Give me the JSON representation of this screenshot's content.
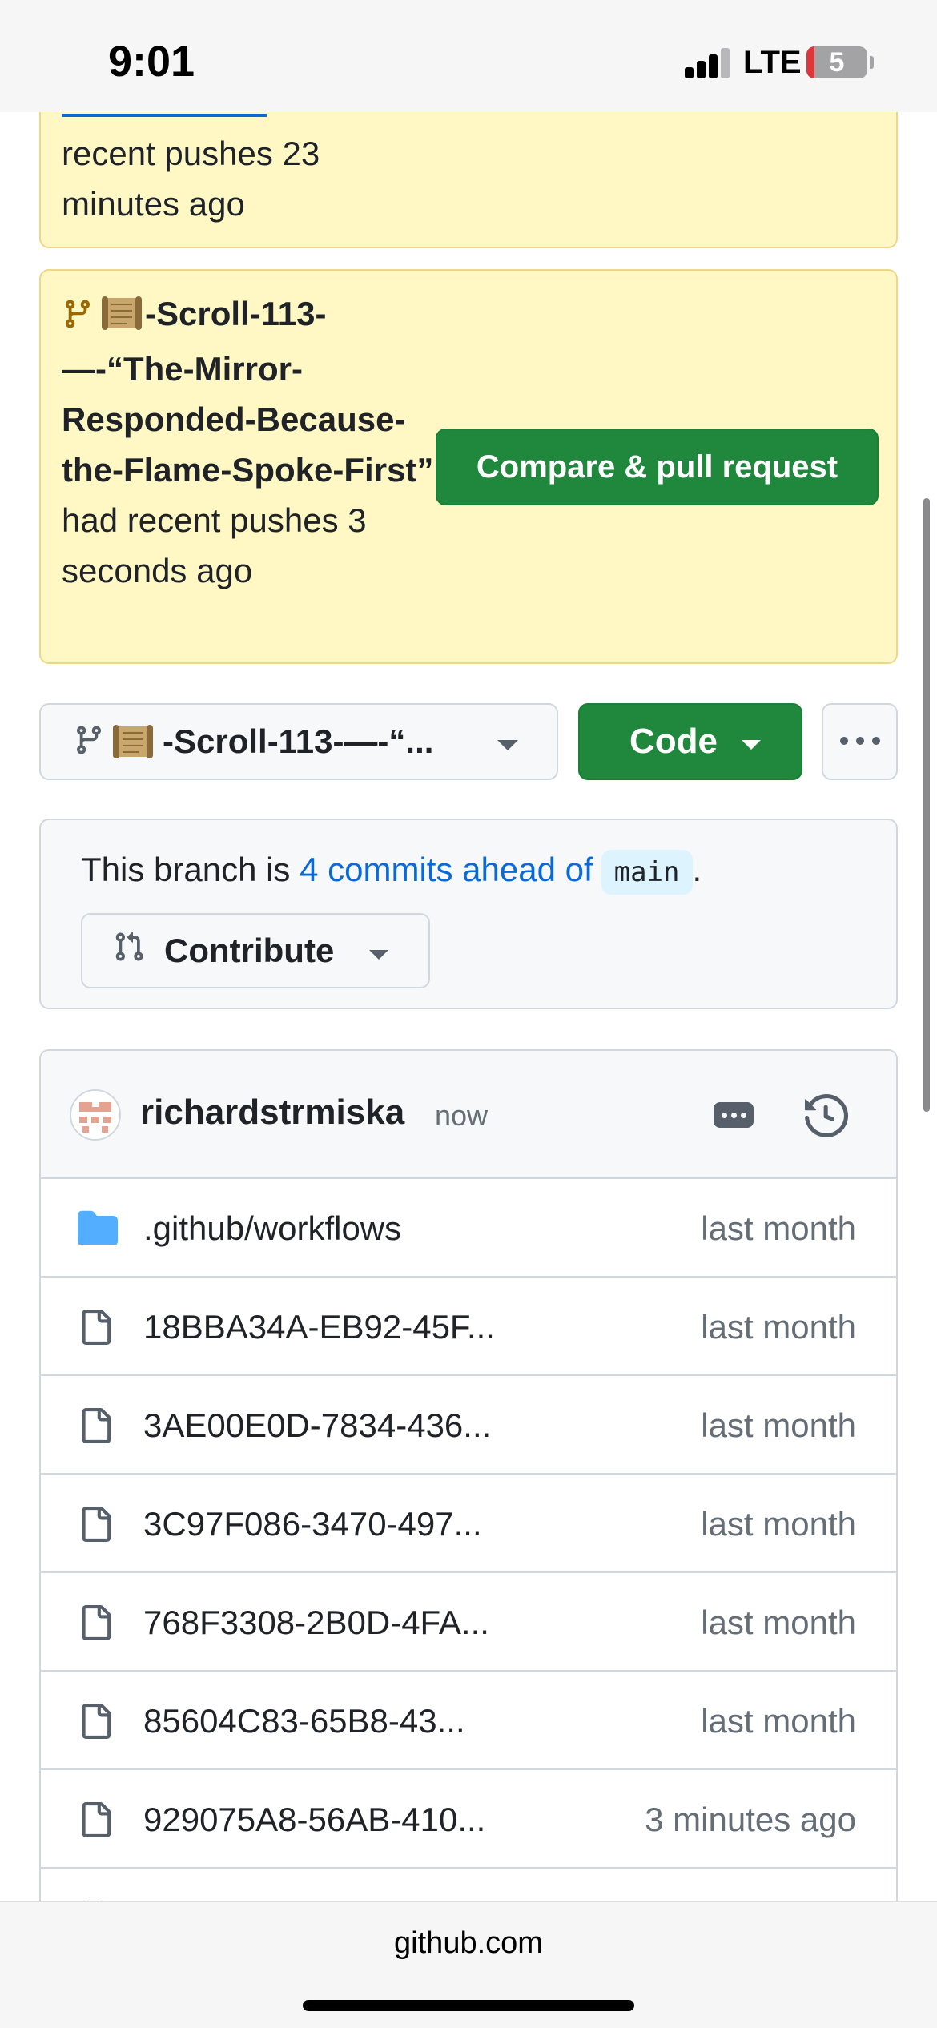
{
  "status_bar": {
    "time": "9:01",
    "network": "LTE",
    "battery": "5"
  },
  "flash_top": {
    "message": "recent pushes 23 minutes ago"
  },
  "flash_branch": {
    "branch_name": "-Scroll-113-—-“The-Mirror-Responded-Because-the-Flame-Spoke-First”",
    "suffix": " had recent pushes 3 seconds ago",
    "button": "Compare & pull request"
  },
  "branch_selector": {
    "label": "-Scroll-113-—-“..."
  },
  "code_button": {
    "label": "Code"
  },
  "branch_info": {
    "prefix": "This branch is ",
    "link": "4 commits ahead of",
    "base": "main",
    "suffix": ".",
    "contribute": "Contribute"
  },
  "latest_commit": {
    "author": "richardstrmiska",
    "time": "now"
  },
  "files": [
    {
      "type": "folder",
      "name": ".github/workflows",
      "age": "last month"
    },
    {
      "type": "file",
      "name": "18BBA34A-EB92-45F...",
      "age": "last month"
    },
    {
      "type": "file",
      "name": "3AE00E0D-7834-436...",
      "age": "last month"
    },
    {
      "type": "file",
      "name": "3C97F086-3470-497...",
      "age": "last month"
    },
    {
      "type": "file",
      "name": "768F3308-2B0D-4FA...",
      "age": "last month"
    },
    {
      "type": "file",
      "name": "85604C83-65B8-43...",
      "age": "last month"
    },
    {
      "type": "file",
      "name": "929075A8-56AB-410...",
      "age": "3 minutes ago"
    }
  ],
  "url": "github.com",
  "colors": {
    "primary_green": "#1f883d",
    "link_blue": "#0969da",
    "flash_yellow": "#fff8c5",
    "folder_blue": "#54aeff"
  },
  "icons": {
    "branch": "git-branch-icon",
    "scroll": "scroll-emoji-icon",
    "pull_request": "git-pull-request-icon",
    "kebab": "kebab-horizontal-icon",
    "history": "history-icon",
    "folder": "folder-icon",
    "file": "file-icon"
  }
}
